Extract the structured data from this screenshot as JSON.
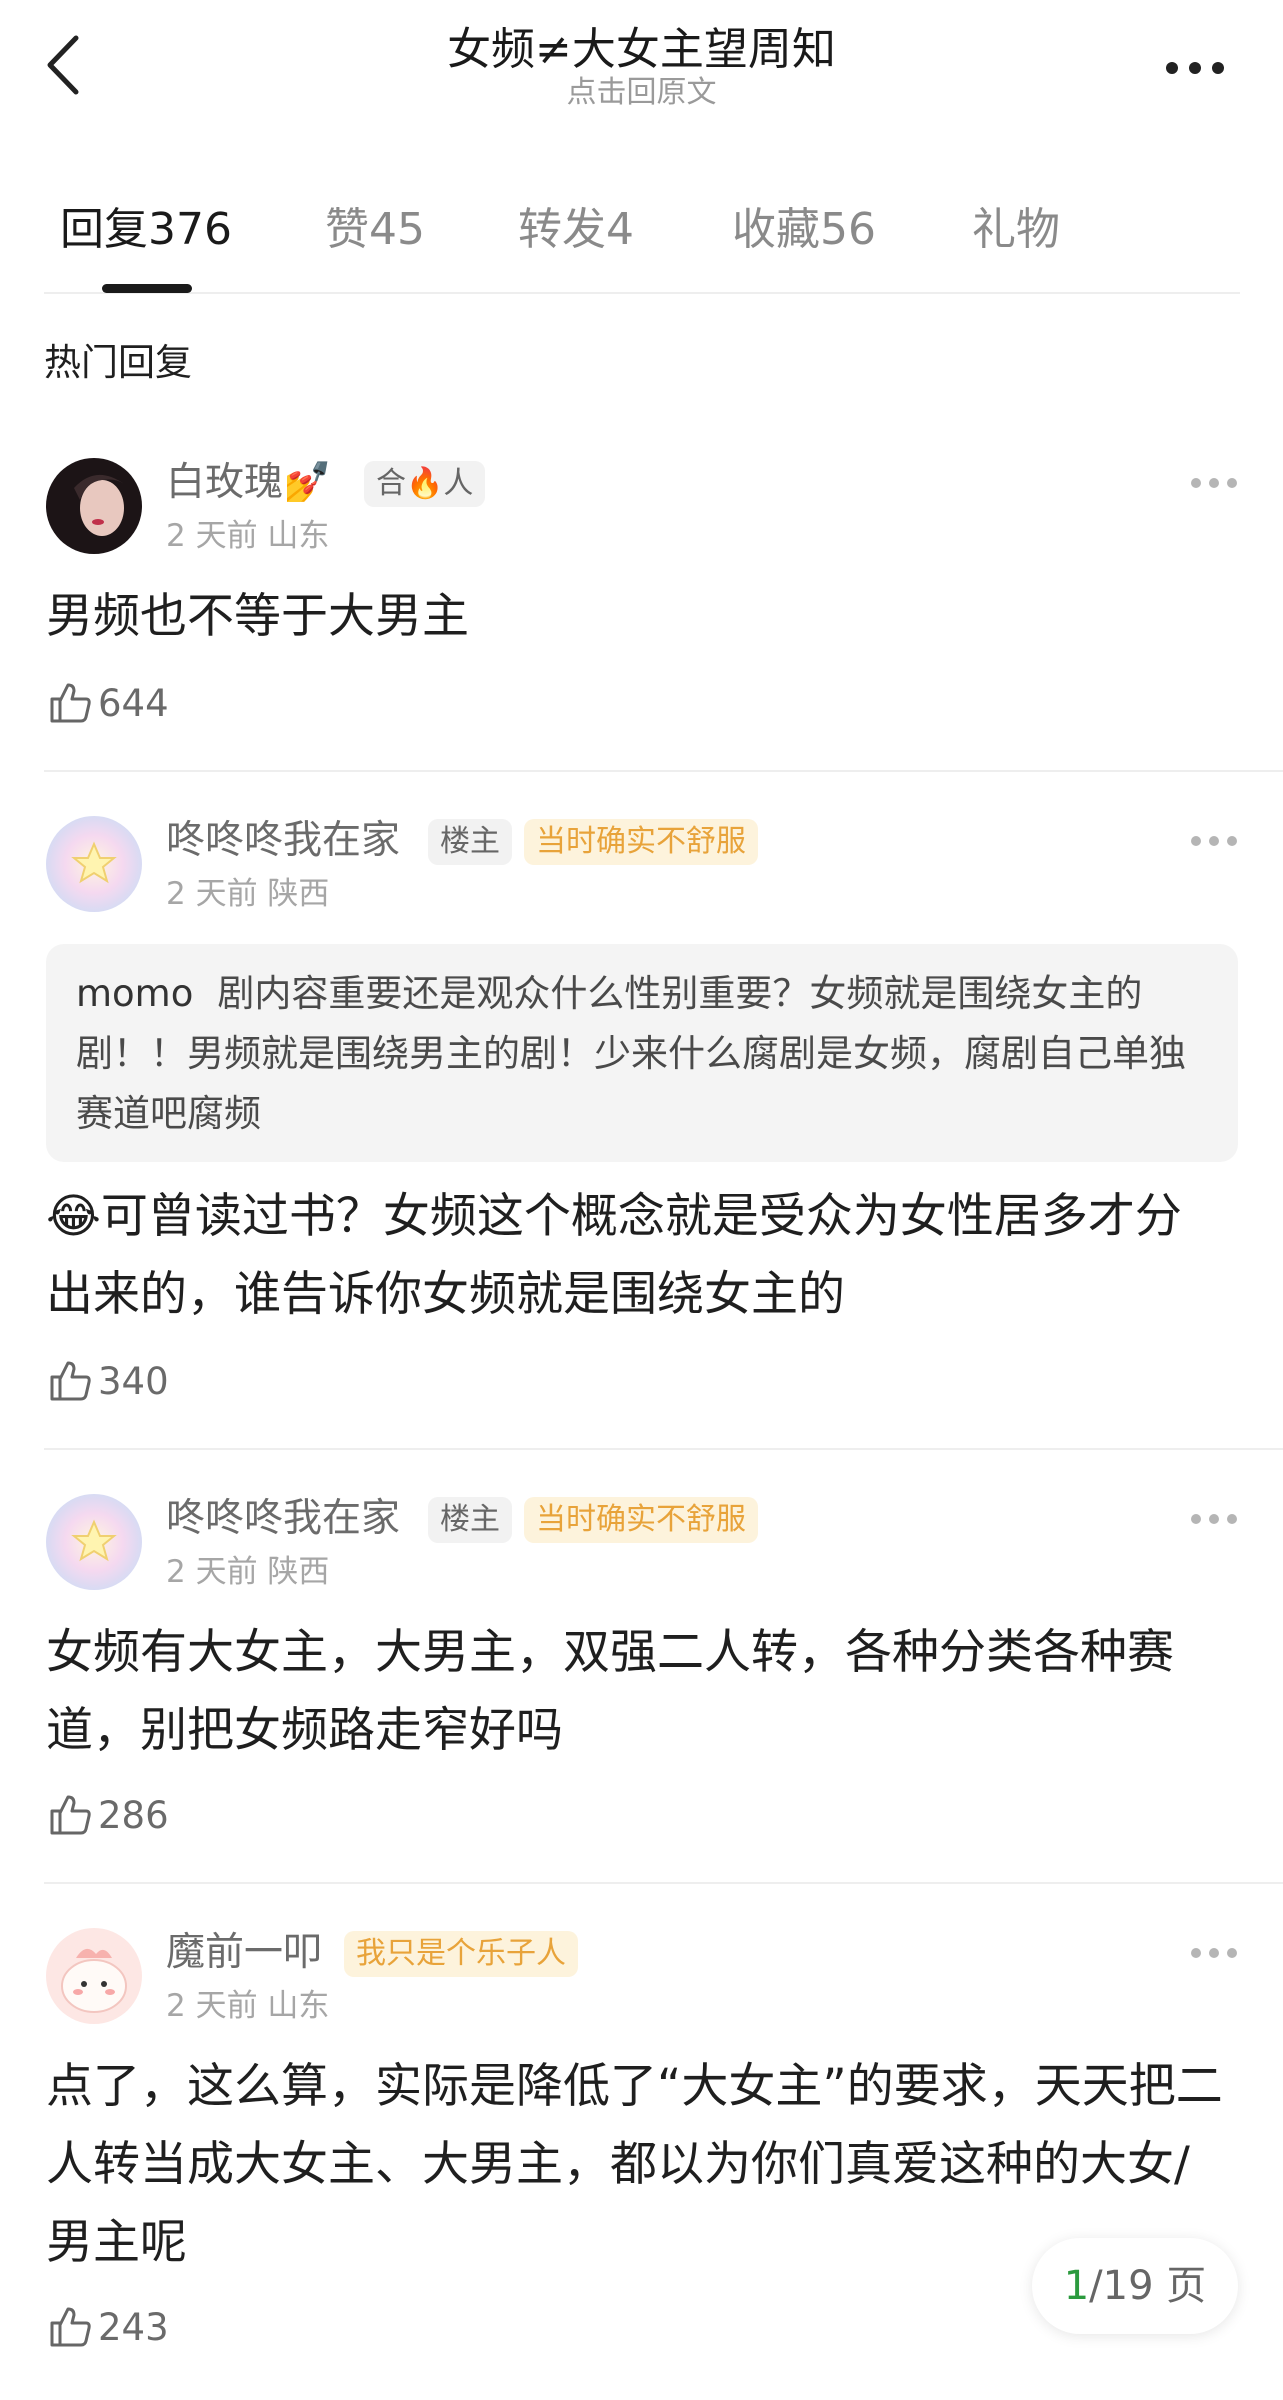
{
  "header": {
    "title": "女频≠大女主望周知",
    "subtitle": "点击回原文"
  },
  "tabs": [
    {
      "label": "回复",
      "count": "376"
    },
    {
      "label": "赞",
      "count": "45"
    },
    {
      "label": "转发",
      "count": "4"
    },
    {
      "label": "收藏",
      "count": "56"
    },
    {
      "label": "礼物",
      "count": ""
    }
  ],
  "section_title": "热门回复",
  "comments": [
    {
      "username": "白玫瑰💅",
      "badge": "合🔥人",
      "meta": "2 天前 山东",
      "text": "男频也不等于大男主",
      "likes": "644"
    },
    {
      "username": "咚咚咚我在家",
      "role_badge": "楼主",
      "badge": "当时确实不舒服",
      "meta": "2 天前 陕西",
      "quote_name": "momo",
      "quote_text": "剧内容重要还是观众什么性别重要？女频就是围绕女主的剧！！男频就是围绕男主的剧！少来什么腐剧是女频，腐剧自己单独赛道吧腐频",
      "text": "😂可曾读过书？女频这个概念就是受众为女性居多才分出来的，谁告诉你女频就是围绕女主的",
      "likes": "340"
    },
    {
      "username": "咚咚咚我在家",
      "role_badge": "楼主",
      "badge": "当时确实不舒服",
      "meta": "2 天前 陕西",
      "text": "女频有大女主，大男主，双强二人转，各种分类各种赛道，别把女频路走窄好吗",
      "likes": "286"
    },
    {
      "username": "魔前一叩",
      "badge": "我只是个乐子人",
      "meta": "2 天前 山东",
      "text": "点了，这么算，实际是降低了“大女主”的要求，天天把二人转当成大女主、大男主，都以为你们真爱这种的大女/男主呢",
      "likes": "243"
    }
  ],
  "pager": {
    "current": "1",
    "total": "/19 页"
  },
  "colors": {
    "accent_green": "#2b9a3e",
    "badge_gold": "#e8a33a",
    "badge_gold_bg": "#fdf3dc"
  }
}
